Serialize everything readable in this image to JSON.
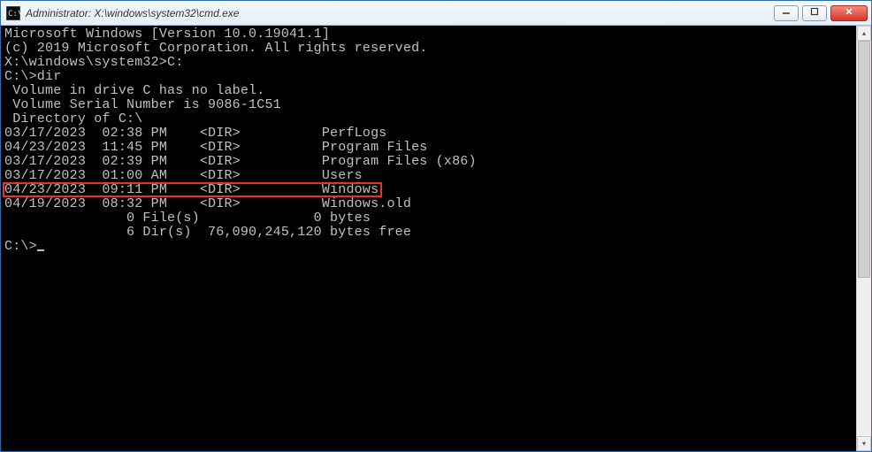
{
  "window": {
    "title": "Administrator: X:\\windows\\system32\\cmd.exe"
  },
  "banner_line1": "Microsoft Windows [Version 10.0.19041.1]",
  "banner_line2": "(c) 2019 Microsoft Corporation. All rights reserved.",
  "prompt1": "X:\\windows\\system32>",
  "cmd1": "C:",
  "prompt2": "C:\\>",
  "cmd2": "dir",
  "vol_label": " Volume in drive C has no label.",
  "vol_serial": " Volume Serial Number is 9086-1C51",
  "dir_header": " Directory of C:\\",
  "entries": [
    {
      "date": "03/17/2023",
      "time": "02:38 PM",
      "type": "<DIR>",
      "name": "PerfLogs"
    },
    {
      "date": "04/23/2023",
      "time": "11:45 PM",
      "type": "<DIR>",
      "name": "Program Files"
    },
    {
      "date": "03/17/2023",
      "time": "02:39 PM",
      "type": "<DIR>",
      "name": "Program Files (x86)"
    },
    {
      "date": "03/17/2023",
      "time": "01:00 AM",
      "type": "<DIR>",
      "name": "Users"
    },
    {
      "date": "04/23/2023",
      "time": "09:11 PM",
      "type": "<DIR>",
      "name": "Windows"
    },
    {
      "date": "04/19/2023",
      "time": "08:32 PM",
      "type": "<DIR>",
      "name": "Windows.old"
    }
  ],
  "summary_files": "               0 File(s)              0 bytes",
  "summary_dirs": "               6 Dir(s)  76,090,245,120 bytes free",
  "prompt3": "C:\\>",
  "highlight_index": 4
}
